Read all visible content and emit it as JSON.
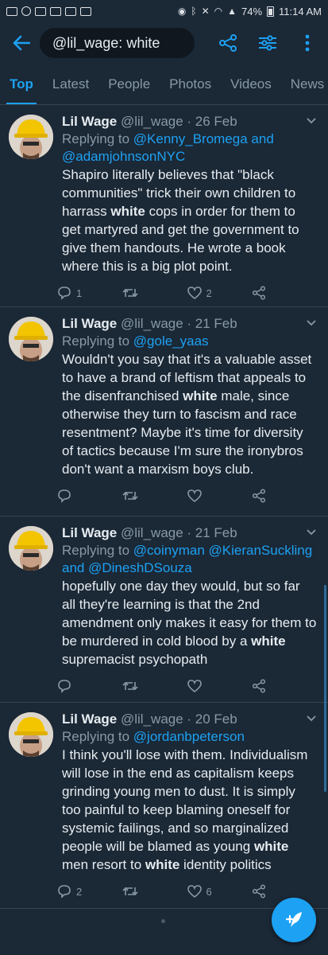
{
  "status": {
    "battery": "74%",
    "time": "11:14 AM"
  },
  "header": {
    "search_value": "@lil_wage: white"
  },
  "tabs": [
    "Top",
    "Latest",
    "People",
    "Photos",
    "Videos",
    "News"
  ],
  "tweets": [
    {
      "name": "Lil Wage",
      "handle": "@lil_wage · 26 Feb",
      "reply_prefix": "Replying to ",
      "mentions": [
        "@Kenny_Bromega",
        "and",
        "@adamjohnsonNYC"
      ],
      "text": [
        {
          "t": "Shapiro literally believes that \"black communities\" trick their own children to harrass "
        },
        {
          "b": "white"
        },
        {
          "t": " cops in order for them to get martyred and get the government to give them handouts. He wrote a book where this is a big plot point."
        }
      ],
      "replies": "1",
      "retweets": "",
      "likes": "2"
    },
    {
      "name": "Lil Wage",
      "handle": "@lil_wage · 21 Feb",
      "reply_prefix": "Replying to ",
      "mentions": [
        "@gole_yaas"
      ],
      "text": [
        {
          "t": "Wouldn't you say that it's a valuable asset to have a brand of leftism that appeals to the disenfranchised "
        },
        {
          "b": "white"
        },
        {
          "t": " male, since otherwise they turn to fascism and race resentment? Maybe it's time for diversity of tactics because I'm sure the ironybros don't want a marxism boys club."
        }
      ],
      "replies": "",
      "retweets": "",
      "likes": ""
    },
    {
      "name": "Lil Wage",
      "handle": "@lil_wage · 21 Feb",
      "reply_prefix": "Replying to ",
      "mentions": [
        "@coinyman",
        "@KieranSuckling",
        "and",
        "@DineshDSouza"
      ],
      "text": [
        {
          "t": "hopefully one day they would, but so far all they're learning is that the 2nd amendment only makes it easy for them to be murdered in cold blood by a "
        },
        {
          "b": "white"
        },
        {
          "t": " supremacist psychopath"
        }
      ],
      "replies": "",
      "retweets": "",
      "likes": ""
    },
    {
      "name": "Lil Wage",
      "handle": "@lil_wage · 20 Feb",
      "reply_prefix": "Replying to ",
      "mentions": [
        "@jordanbpeterson"
      ],
      "text": [
        {
          "t": "I think you'll lose with them. Individualism will lose in the end as capitalism keeps grinding young men to dust. It is simply too painful to keep blaming oneself for systemic failings, and so marginalized people will be blamed as young "
        },
        {
          "b": "white"
        },
        {
          "t": " men resort to "
        },
        {
          "b": "white"
        },
        {
          "t": " identity politics"
        }
      ],
      "replies": "2",
      "retweets": "",
      "likes": "6"
    }
  ],
  "colors": {
    "accent": "#1da1f2",
    "background": "#1b2836",
    "muted": "#8899a6"
  },
  "icons": [
    "back-arrow-icon",
    "share-icon",
    "filter-icon",
    "more-icon",
    "reply-icon",
    "retweet-icon",
    "like-icon",
    "share-icon",
    "chevron-down-icon",
    "compose-icon"
  ]
}
